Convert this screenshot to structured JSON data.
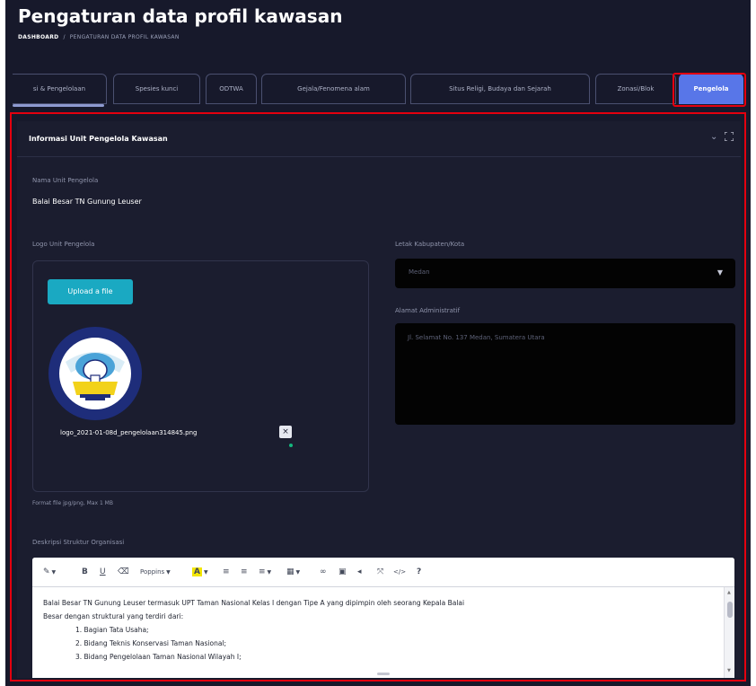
{
  "header": {
    "title": "Pengaturan data profil kawasan",
    "breadcrumb_home": "DASHBOARD",
    "breadcrumb_sep": "/",
    "breadcrumb_current": "PENGATURAN DATA PROFIL KAWASAN"
  },
  "tabs": [
    {
      "label": "si & Pengelolaan"
    },
    {
      "label": "Spesies kunci"
    },
    {
      "label": "ODTWA"
    },
    {
      "label": "Gejala/Fenomena alam"
    },
    {
      "label": "Situs Religi, Budaya dan Sejarah"
    },
    {
      "label": "Zonasi/Blok"
    },
    {
      "label": "Pengelola",
      "active": true
    }
  ],
  "panel": {
    "title": "Informasi Unit Pengelola Kawasan",
    "collapse_icon": "chevron-down-icon",
    "expand_icon": "fullscreen-icon",
    "unit_name_label": "Nama Unit Pengelola",
    "unit_name_value": "Balai Besar TN Gunung Leuser",
    "logo_label": "Logo Unit Pengelola",
    "upload_button": "Upload a file",
    "uploaded_file_name": "logo_2021-01-08d_pengelolaan314845.png",
    "remove_file_symbol": "×",
    "file_format_note": "Format file jpg/png, Max 1 MB",
    "kabupaten_label": "Letak Kabupaten/Kota",
    "kabupaten_value": "Medan",
    "alamat_label": "Alamat Administratif",
    "alamat_value": "Jl. Selamat No. 137 Medan, Sumatera Utara",
    "struktur_label": "Deskripsi Struktur Organisasi"
  },
  "editor": {
    "font_name": "Poppins",
    "toolbar_icons": [
      "magic-wand-icon",
      "bold-icon",
      "underline-icon",
      "eraser-icon",
      "font-family-select",
      "text-color-icon",
      "unordered-list-icon",
      "ordered-list-icon",
      "paragraph-align-icon",
      "table-icon",
      "link-icon",
      "image-icon",
      "video-icon",
      "fullscreen-icon",
      "code-view-icon",
      "help-icon"
    ],
    "content_lines": [
      "Balai Besar TN Gunung Leuser termasuk UPT Taman Nasional Kelas I dengan Tipe A yang dipimpin oleh seorang Kepala Balai",
      "Besar dengan struktural yang terdiri dari:"
    ],
    "list_items": [
      "1. Bagian Tata Usaha;",
      "2. Bidang Teknis Konservasi Taman Nasional;",
      "3. Bidang Pengelolaan Taman Nasional Wilayah I;"
    ]
  },
  "colors": {
    "background": "#17192b",
    "panel": "#1b1d2f",
    "active_tab": "#5876e8",
    "upload_button": "#1aa9c2",
    "highlight": "#e4000f"
  }
}
